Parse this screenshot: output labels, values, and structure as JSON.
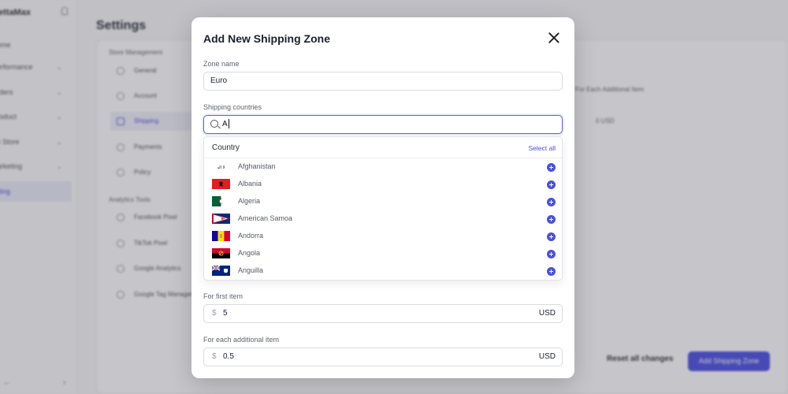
{
  "app": {
    "brand": "ettaMax",
    "sidebar_items": [
      {
        "label": "ome",
        "chevron": false
      },
      {
        "label": "erformance",
        "chevron": true
      },
      {
        "label": "rders",
        "chevron": true
      },
      {
        "label": "roduct",
        "chevron": true
      },
      {
        "label": "y Store",
        "chevron": true
      },
      {
        "label": "arketing",
        "chevron": true
      },
      {
        "label": "tting",
        "chevron": false,
        "active": true
      }
    ],
    "collapse_left": "←",
    "collapse_right": "›",
    "page_title": "Settings",
    "store_management_title": "Store Management",
    "store_items": [
      "General",
      "Account",
      "Shipping",
      "Payments",
      "Policy"
    ],
    "analytics_title": "Analytics Tools",
    "analytics_items": [
      "Facebook Pixel",
      "TikTok Pixel",
      "Google Analytics",
      "Google Tag Manager"
    ],
    "right_text_1": "For Each Additional Item",
    "right_text_2": "0 USD",
    "reset_label": "Reset all changes",
    "add_zone_label": "Add Shipping Zone"
  },
  "modal": {
    "title": "Add New Shipping Zone",
    "zone_name_label": "Zone name",
    "zone_name_value": "Euro",
    "countries_label": "Shipping countries",
    "search_value": "A",
    "dropdown": {
      "header": "Country",
      "select_all": "Select all",
      "countries": [
        {
          "name": "Afghanistan",
          "flag": "afghanistan-flag"
        },
        {
          "name": "Albania",
          "flag": "albania-flag"
        },
        {
          "name": "Algeria",
          "flag": "algeria-flag"
        },
        {
          "name": "American Samoa",
          "flag": "american-samoa-flag"
        },
        {
          "name": "Andorra",
          "flag": "andorra-flag"
        },
        {
          "name": "Angola",
          "flag": "angola-flag"
        },
        {
          "name": "Anguilla",
          "flag": "anguilla-flag"
        }
      ]
    },
    "first_item_label": "For first item",
    "first_item_prefix": "$",
    "first_item_value": "5",
    "first_item_currency": "USD",
    "additional_item_label": "For each additional item",
    "additional_item_prefix": "$",
    "additional_item_value": "0.5",
    "additional_item_currency": "USD"
  },
  "colors": {
    "accent": "#4b4fe0",
    "overlay": "rgba(60,62,72,0.28)"
  }
}
